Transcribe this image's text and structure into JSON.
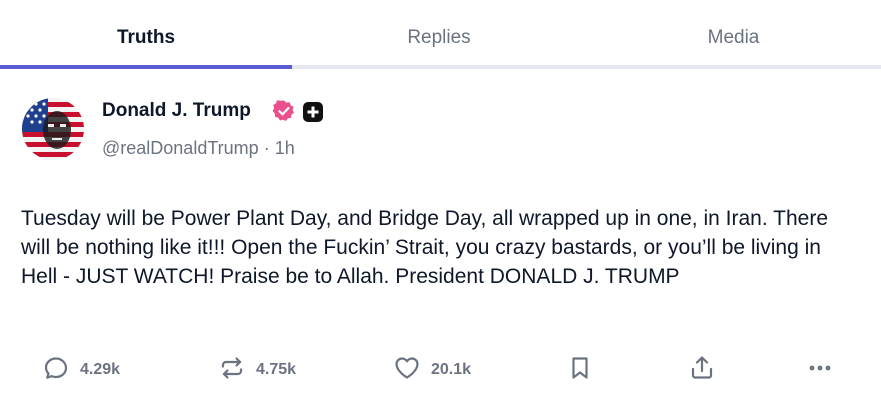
{
  "tabs": [
    {
      "label": "Truths",
      "active": true
    },
    {
      "label": "Replies",
      "active": false
    },
    {
      "label": "Media",
      "active": false
    }
  ],
  "post": {
    "author_name": "Donald J. Trump",
    "handle": "@realDonaldTrump",
    "separator": "·",
    "time": "1h",
    "verified_icon": "verified-badge-icon",
    "verified_color": "#e9508d",
    "body": "Tuesday will be Power Plant Day, and Bridge Day, all wrapped up in one, in Iran. There will be nothing like it!!! Open the Fuckin’ Strait, you crazy bastards, or you’ll be living in Hell - JUST WATCH! Praise be to Allah. President DONALD J. TRUMP"
  },
  "actions": {
    "replies": "4.29k",
    "retruths": "4.75k",
    "likes": "20.1k"
  },
  "colors": {
    "accent": "#5b5bd6",
    "text": "#0f172a",
    "muted": "#6b7280"
  }
}
